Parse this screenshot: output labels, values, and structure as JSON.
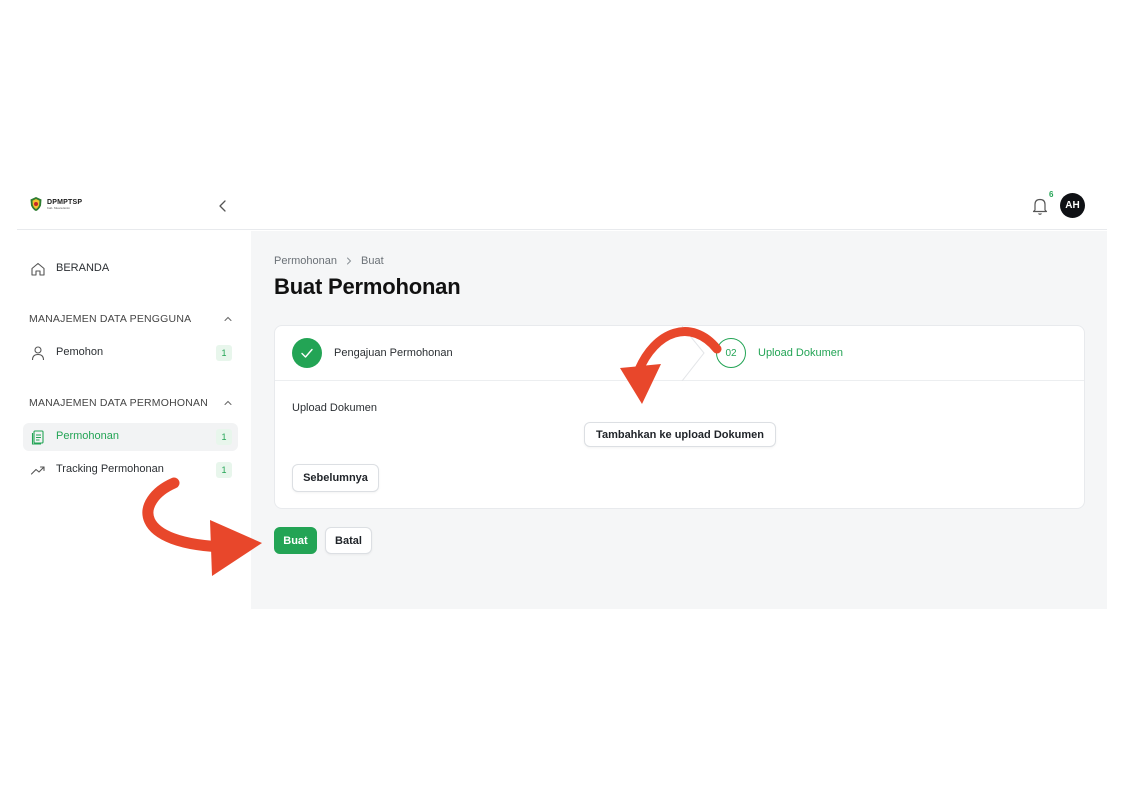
{
  "brand": {
    "title": "DPMPTSP",
    "subtitle": "Kab. Muara Enim"
  },
  "header": {
    "notification_count": "6",
    "avatar_initials": "AH"
  },
  "sidebar": {
    "home_label": "BERANDA",
    "sections": [
      {
        "title": "MANAJEMEN DATA PENGGUNA",
        "items": [
          {
            "label": "Pemohon",
            "count": "1"
          }
        ]
      },
      {
        "title": "MANAJEMEN DATA PERMOHONAN",
        "items": [
          {
            "label": "Permohonan",
            "count": "1"
          },
          {
            "label": "Tracking Permohonan",
            "count": "1"
          }
        ]
      }
    ]
  },
  "breadcrumb": [
    "Permohonan",
    "Buat"
  ],
  "page_title": "Buat Permohonan",
  "stepper": {
    "step1": {
      "label": "Pengajuan Permohonan",
      "status": "done"
    },
    "step2": {
      "number": "02",
      "label": "Upload Dokumen",
      "status": "active"
    }
  },
  "form": {
    "upload_label": "Upload Dokumen",
    "add_upload_button": "Tambahkan ke upload Dokumen",
    "prev_button": "Sebelumnya"
  },
  "actions": {
    "create_button": "Buat",
    "cancel_button": "Batal"
  },
  "colors": {
    "accent": "#23a455",
    "annotation_arrow": "#e8472b"
  }
}
